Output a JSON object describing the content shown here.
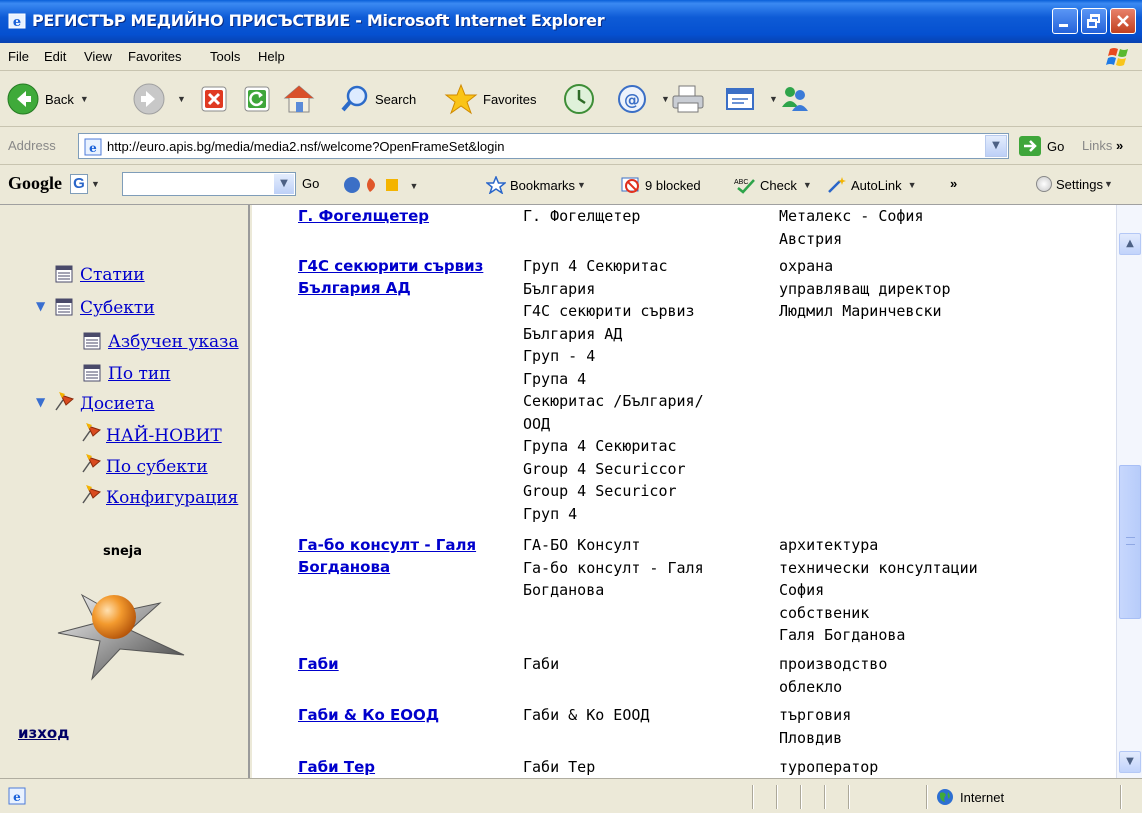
{
  "window": {
    "title": "РЕГИСТЪР МЕДИЙНО ПРИСЪСТВИЕ - Microsoft Internet Explorer"
  },
  "menu": [
    "File",
    "Edit",
    "View",
    "Favorites",
    "Tools",
    "Help"
  ],
  "toolbar": {
    "back": "Back",
    "search": "Search",
    "favorites": "Favorites"
  },
  "address": {
    "label": "Address",
    "url": "http://euro.apis.bg/media/media2.nsf/welcome?OpenFrameSet&login",
    "go": "Go",
    "links": "Links"
  },
  "googlebar": {
    "logo": "Google",
    "go": "Go",
    "bookmarks": "Bookmarks",
    "blocked": "9 blocked",
    "check": "Check",
    "autolink": "AutoLink",
    "settings": "Settings"
  },
  "nav": {
    "items": [
      "Статии",
      "Субекти",
      "Азбучен указа",
      "По тип",
      "Досиета",
      "НАЙ-НОВИТ",
      "По субекти",
      "Конфигурация"
    ],
    "user": "sneja",
    "exit": "изход"
  },
  "table": {
    "rows": [
      {
        "name": "Г. Фогелщетер",
        "aliases": [
          "Г. Фогелщетер"
        ],
        "info": [
          "Металекс - София",
          "Австрия"
        ]
      },
      {
        "name": "Г4С секюрити сървиз България АД",
        "aliases": [
          "Груп 4 Секюритас",
          "България",
          "Г4С секюрити сървиз",
          "България АД",
          "Груп - 4",
          "Група 4",
          "Секюритас /България/",
          "ООД",
          "Група 4 Секюритас",
          "Group 4 Securiccor",
          "Group 4 Securicor",
          "Груп 4"
        ],
        "info": [
          "охрана",
          "управляващ директор",
          "Людмил Маринчевски"
        ]
      },
      {
        "name": "Га-бо консулт - Галя Богданова",
        "aliases": [
          "ГА-БО Консулт",
          "Га-бо консулт - Галя",
          "Богданова"
        ],
        "info": [
          "архитектура",
          "технически консултации",
          "София",
          "собственик",
          "Галя Богданова"
        ]
      },
      {
        "name": "Габи",
        "aliases": [
          "Габи"
        ],
        "info": [
          "производство",
          "облекло"
        ]
      },
      {
        "name": "Габи & Ко ЕООД",
        "aliases": [
          "Габи & Ко ЕООД"
        ],
        "info": [
          "търговия",
          "Пловдив"
        ]
      },
      {
        "name": "Габи Тер",
        "aliases": [
          "Габи Тер"
        ],
        "info": [
          "туроператор"
        ]
      }
    ]
  },
  "status": {
    "zone": "Internet"
  }
}
